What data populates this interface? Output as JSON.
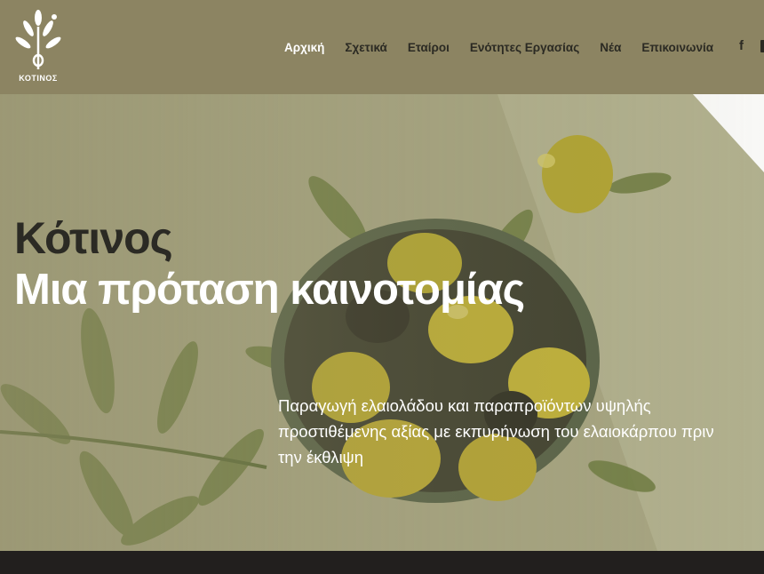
{
  "brand": {
    "logo_text": "ΚΟΤΙΝΟΣ"
  },
  "nav": {
    "items": [
      {
        "label": "Αρχική",
        "active": true
      },
      {
        "label": "Σχετικά",
        "active": false
      },
      {
        "label": "Εταίροι",
        "active": false
      },
      {
        "label": "Ενότητες Εργασίας",
        "active": false
      },
      {
        "label": "Νέα",
        "active": false
      },
      {
        "label": "Επικοινωνία",
        "active": false
      }
    ]
  },
  "social": {
    "facebook": "f"
  },
  "hero": {
    "title": "Κότινος",
    "subtitle": "Μια πρόταση καινοτομίας",
    "description": "Παραγωγή ελαιολάδου και παραπροϊόντων υψηλής προστιθέμενης αξίας με εκπυρήνωση του ελαιοκάρπου πριν την έκθλιψη"
  },
  "colors": {
    "header_bg": "#8c8462",
    "nav_text": "#2b2a23",
    "nav_active": "#ffffff",
    "title_dark": "#2b2a24",
    "footer_bg": "#221f1e"
  },
  "icons": [
    "olive-branch-logo-icon",
    "facebook-icon"
  ]
}
